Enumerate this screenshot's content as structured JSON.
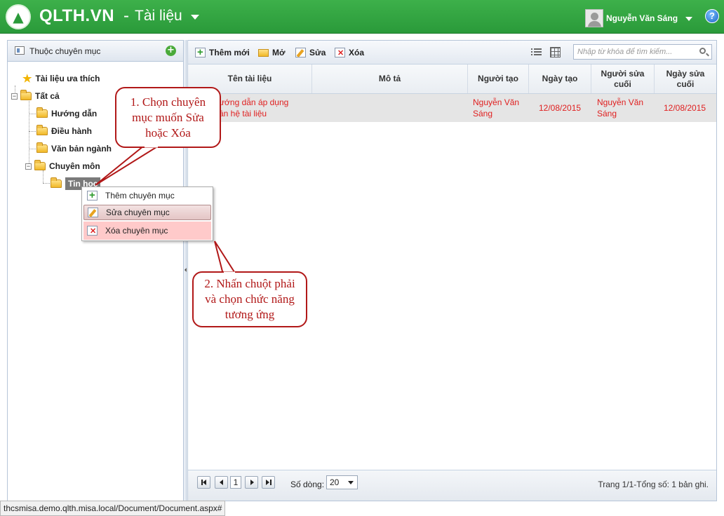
{
  "app": {
    "brand": "QLTH.VN",
    "separator": "-",
    "section": "Tài liệu",
    "user_name": "Nguyễn Văn Sáng",
    "logo_glyph": "▲",
    "help_glyph": "?"
  },
  "colors": {
    "brand_green": "#2a9a3a",
    "callout_red": "#b11818",
    "row_text_red": "#e02020"
  },
  "sidebar": {
    "title": "Thuộc chuyên mục",
    "add_glyph": "+",
    "tree": {
      "favorites": "Tài liệu ưa thích",
      "all": "Tất cả",
      "huong_dan": "Hướng dẫn",
      "dieu_hanh": "Điều hành",
      "van_ban_nganh": "Văn bản ngành",
      "chuyen_mon": "Chuyên môn",
      "tin_hoc": "Tin học"
    }
  },
  "toolbar": {
    "new_label": "Thêm mới",
    "open_label": "Mở",
    "edit_label": "Sửa",
    "delete_label": "Xóa",
    "search_placeholder": "Nhập từ khóa để tìm kiếm..."
  },
  "grid": {
    "columns": [
      "Tên tài liệu",
      "Mô tả",
      "Người tạo",
      "Ngày tạo",
      "Người sửa cuối",
      "Ngày sửa cuối"
    ],
    "rows": [
      {
        "name": "ướng dẫn áp dụng\nần hệ tài liệu",
        "description": "",
        "creator": "Nguyễn Văn Sáng",
        "created": "12/08/2015",
        "modifier": "Nguyễn Văn Sáng",
        "modified": "12/08/2015"
      }
    ]
  },
  "pager": {
    "page": "1",
    "rows_label": "Số dòng:",
    "rows_value": "20",
    "info": "Trang 1/1-Tổng số: 1 bản ghi."
  },
  "context_menu": {
    "add": "Thêm chuyên mục",
    "edit": "Sửa chuyên mục",
    "delete": "Xóa chuyên mục"
  },
  "callouts": {
    "step1": "1. Chọn chuyên mục muốn Sửa hoặc Xóa",
    "step2": "2. Nhấn chuột phải và chọn chức năng tương ứng"
  },
  "statusbar": {
    "url": "thcsmisa.demo.qlth.misa.local/Document/Document.aspx#"
  }
}
